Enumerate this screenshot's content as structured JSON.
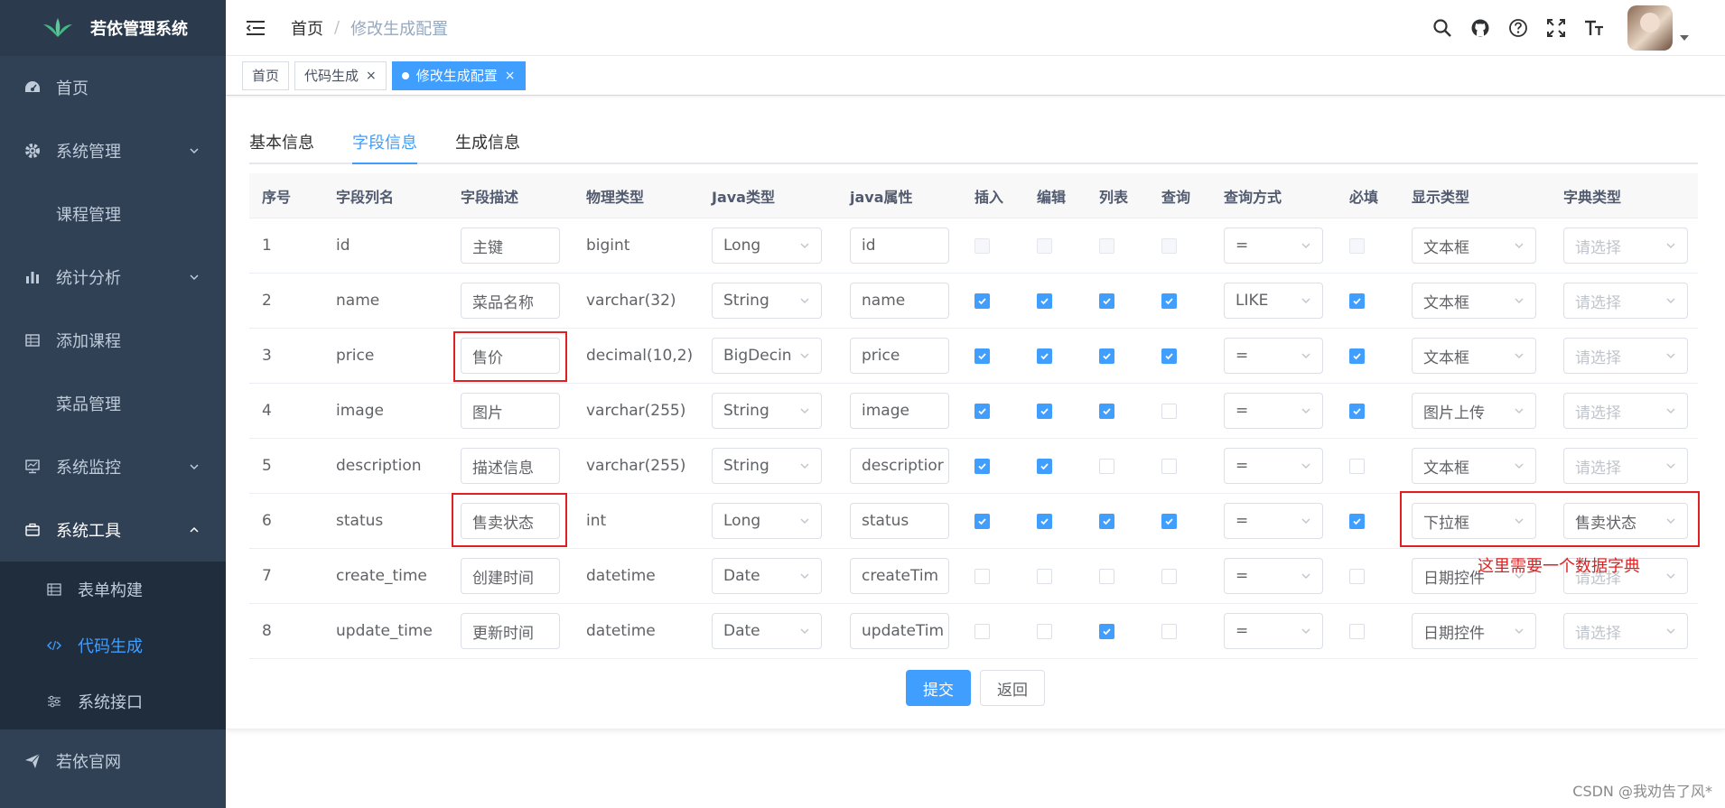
{
  "app": {
    "title": "若依管理系统"
  },
  "sidebar": {
    "items": [
      {
        "label": "首页",
        "icon": "dashboard-icon"
      },
      {
        "label": "系统管理",
        "icon": "gear-icon"
      },
      {
        "label": "课程管理"
      },
      {
        "label": "统计分析",
        "icon": "bar-chart-icon"
      },
      {
        "label": "添加课程",
        "icon": "table-icon"
      },
      {
        "label": "菜品管理"
      },
      {
        "label": "系统监控",
        "icon": "monitor-icon"
      },
      {
        "label": "系统工具",
        "icon": "toolbox-icon"
      },
      {
        "label": "若依官网",
        "icon": "send-icon"
      }
    ],
    "tool_sub": [
      {
        "label": "表单构建",
        "icon": "form-icon"
      },
      {
        "label": "代码生成",
        "icon": "code-icon"
      },
      {
        "label": "系统接口",
        "icon": "sliders-icon"
      }
    ]
  },
  "breadcrumb": {
    "home": "首页",
    "sep": "/",
    "current": "修改生成配置"
  },
  "tags": [
    {
      "label": "首页"
    },
    {
      "label": "代码生成",
      "close": "×"
    },
    {
      "label": "修改生成配置",
      "close": "×"
    }
  ],
  "tabs": [
    "基本信息",
    "字段信息",
    "生成信息"
  ],
  "columns": [
    "序号",
    "字段列名",
    "字段描述",
    "物理类型",
    "Java类型",
    "java属性",
    "插入",
    "编辑",
    "列表",
    "查询",
    "查询方式",
    "必填",
    "显示类型",
    "字典类型"
  ],
  "rows": [
    {
      "no": "1",
      "name": "id",
      "desc": "主键",
      "ptype": "bigint",
      "jtype": "Long",
      "jprop": "id",
      "insert": false,
      "edit": false,
      "list": false,
      "query": false,
      "qmode": "=",
      "required": false,
      "display": "文本框",
      "dict": "请选择"
    },
    {
      "no": "2",
      "name": "name",
      "desc": "菜品名称",
      "ptype": "varchar(32)",
      "jtype": "String",
      "jprop": "name",
      "insert": true,
      "edit": true,
      "list": true,
      "query": true,
      "qmode": "LIKE",
      "required": true,
      "display": "文本框",
      "dict": "请选择"
    },
    {
      "no": "3",
      "name": "price",
      "desc": "售价",
      "ptype": "decimal(10,2)",
      "jtype": "BigDecin",
      "jprop": "price",
      "insert": true,
      "edit": true,
      "list": true,
      "query": true,
      "qmode": "=",
      "required": true,
      "display": "文本框",
      "dict": "请选择"
    },
    {
      "no": "4",
      "name": "image",
      "desc": "图片",
      "ptype": "varchar(255)",
      "jtype": "String",
      "jprop": "image",
      "insert": true,
      "edit": true,
      "list": true,
      "query": false,
      "qmode": "=",
      "required": true,
      "display": "图片上传",
      "dict": "请选择"
    },
    {
      "no": "5",
      "name": "description",
      "desc": "描述信息",
      "ptype": "varchar(255)",
      "jtype": "String",
      "jprop": "descriptior",
      "insert": true,
      "edit": true,
      "list": false,
      "query": false,
      "qmode": "=",
      "required": false,
      "display": "文本框",
      "dict": "请选择"
    },
    {
      "no": "6",
      "name": "status",
      "desc": "售卖状态",
      "ptype": "int",
      "jtype": "Long",
      "jprop": "status",
      "insert": true,
      "edit": true,
      "list": true,
      "query": true,
      "qmode": "=",
      "required": true,
      "display": "下拉框",
      "dict": "售卖状态"
    },
    {
      "no": "7",
      "name": "create_time",
      "desc": "创建时间",
      "ptype": "datetime",
      "jtype": "Date",
      "jprop": "createTim",
      "insert": false,
      "edit": false,
      "list": false,
      "query": false,
      "qmode": "=",
      "required": false,
      "display": "日期控件",
      "dict": "请选择"
    },
    {
      "no": "8",
      "name": "update_time",
      "desc": "更新时间",
      "ptype": "datetime",
      "jtype": "Date",
      "jprop": "updateTim",
      "insert": false,
      "edit": false,
      "list": true,
      "query": false,
      "qmode": "=",
      "required": false,
      "display": "日期控件",
      "dict": "请选择"
    }
  ],
  "buttons": {
    "submit": "提交",
    "back": "返回"
  },
  "annotation": {
    "text": "这里需要一个数据字典"
  },
  "watermark": "CSDN @我劝告了风*",
  "colors": {
    "sidebar_bg": "#304156",
    "primary": "#409eff",
    "annotation": "#e02020"
  }
}
